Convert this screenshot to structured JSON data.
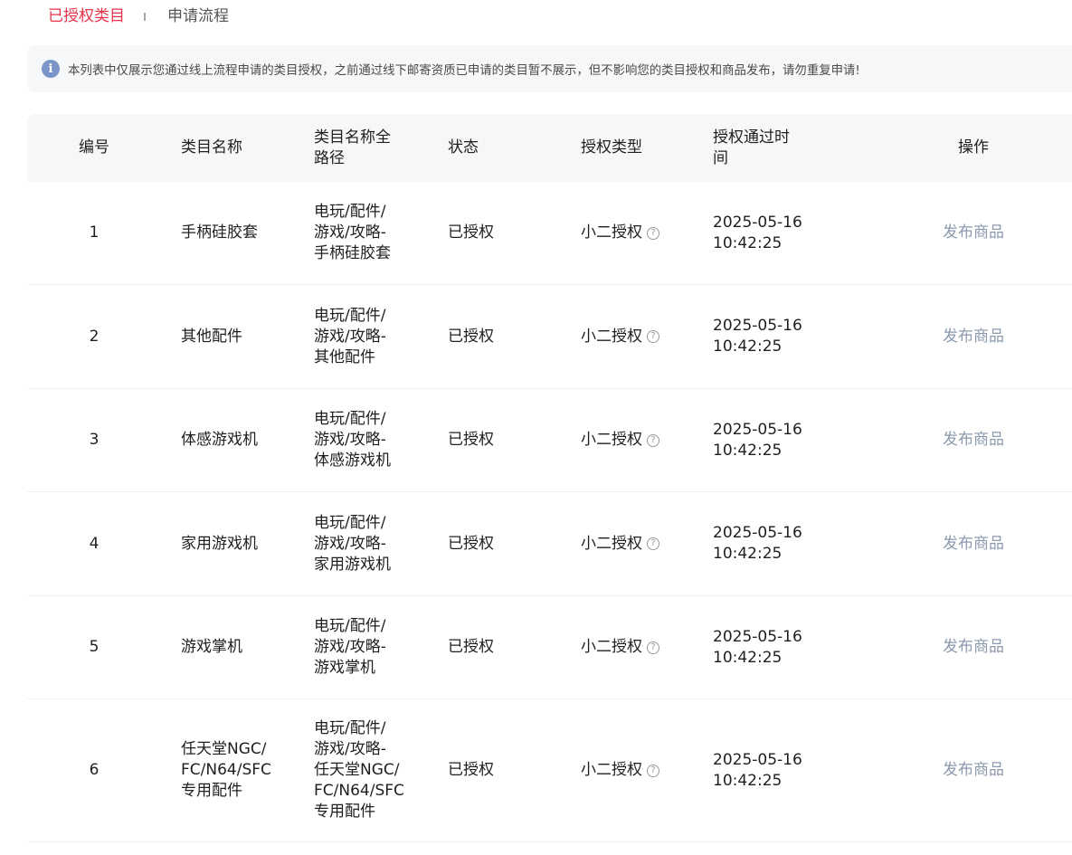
{
  "tabs": [
    {
      "label": "已授权类目",
      "active": true
    },
    {
      "label": "申请流程",
      "active": false
    }
  ],
  "notice": {
    "icon": "info-icon",
    "text": "本列表中仅展示您通过线上流程申请的类目授权，之前通过线下邮寄资质已申请的类目暂不展示，但不影响您的类目授权和商品发布，请勿重复申请!"
  },
  "table": {
    "headers": {
      "id": "编号",
      "name": "类目名称",
      "path": [
        "类目名称全",
        "路径"
      ],
      "status": "状态",
      "type": "授权类型",
      "time": [
        "授权通过时",
        "间"
      ],
      "op": "操作"
    },
    "rows": [
      {
        "id": "1",
        "name": [
          "手柄硅胶套"
        ],
        "path": [
          "电玩/配件/",
          "游戏/攻略-",
          "手柄硅胶套"
        ],
        "status": "已授权",
        "type": "小二授权",
        "time": [
          "2025-05-16",
          "10:42:25"
        ],
        "op": "发布商品"
      },
      {
        "id": "2",
        "name": [
          "其他配件"
        ],
        "path": [
          "电玩/配件/",
          "游戏/攻略-",
          "其他配件"
        ],
        "status": "已授权",
        "type": "小二授权",
        "time": [
          "2025-05-16",
          "10:42:25"
        ],
        "op": "发布商品"
      },
      {
        "id": "3",
        "name": [
          "体感游戏机"
        ],
        "path": [
          "电玩/配件/",
          "游戏/攻略-",
          "体感游戏机"
        ],
        "status": "已授权",
        "type": "小二授权",
        "time": [
          "2025-05-16",
          "10:42:25"
        ],
        "op": "发布商品"
      },
      {
        "id": "4",
        "name": [
          "家用游戏机"
        ],
        "path": [
          "电玩/配件/",
          "游戏/攻略-",
          "家用游戏机"
        ],
        "status": "已授权",
        "type": "小二授权",
        "time": [
          "2025-05-16",
          "10:42:25"
        ],
        "op": "发布商品"
      },
      {
        "id": "5",
        "name": [
          "游戏掌机"
        ],
        "path": [
          "电玩/配件/",
          "游戏/攻略-",
          "游戏掌机"
        ],
        "status": "已授权",
        "type": "小二授权",
        "time": [
          "2025-05-16",
          "10:42:25"
        ],
        "op": "发布商品"
      },
      {
        "id": "6",
        "name": [
          "任天堂NGC/",
          "FC/N64/SFC",
          "专用配件"
        ],
        "path": [
          "电玩/配件/",
          "游戏/攻略-",
          "任天堂NGC/",
          "FC/N64/SFC",
          "专用配件"
        ],
        "status": "已授权",
        "type": "小二授权",
        "time": [
          "2025-05-16",
          "10:42:25"
        ],
        "op": "发布商品"
      }
    ]
  },
  "colors": {
    "accent": "#e8334a",
    "link_muted": "#8c9aae",
    "header_bg": "#f6f7f9",
    "info_icon": "#7b95c9"
  }
}
